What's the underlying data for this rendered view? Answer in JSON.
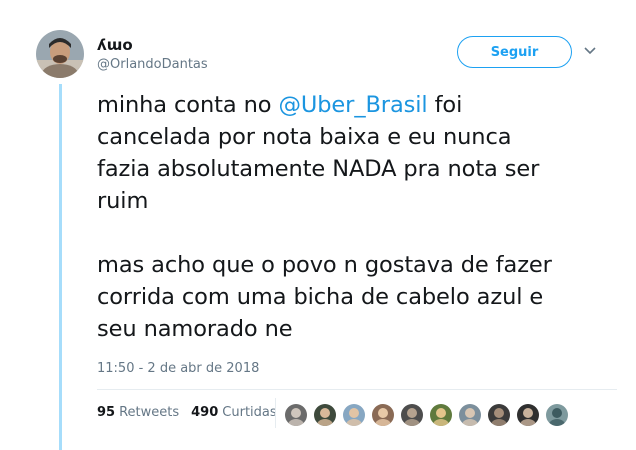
{
  "tweet": {
    "display_name": "ʎɯo",
    "username": "@OrlandoDantas",
    "follow_label": "Seguir",
    "text_line1_prefix": "minha conta no ",
    "mention": "@Uber_Brasil",
    "text_line1_suffix": " foi\ncancelada por nota baixa e eu nunca\nfazia absolutamente NADA pra nota ser\nruim",
    "text_para2": "mas acho que o povo n gostava de fazer\ncorrida com uma bicha de cabelo azul e\nseu namorado ne",
    "timestamp": "11:50 - 2 de abr de 2018",
    "retweets_count": "95",
    "retweets_label": "Retweets",
    "likes_count": "490",
    "likes_label": "Curtidas"
  },
  "colors": {
    "accent": "#1da1f2",
    "mention": "#1b95e0",
    "thread_line": "#a6ddfb",
    "secondary_text": "#657786"
  },
  "icons": {
    "more": "chevron-down-icon"
  },
  "likers": [
    {
      "name": "liker-1",
      "bg": "#6b6b6b",
      "fg": "#cfc6bd"
    },
    {
      "name": "liker-2",
      "bg": "#3e4a3c",
      "fg": "#d9b99a"
    },
    {
      "name": "liker-3",
      "bg": "#87a7c2",
      "fg": "#e2c4a5"
    },
    {
      "name": "liker-4",
      "bg": "#8a6a55",
      "fg": "#e8c9a7"
    },
    {
      "name": "liker-5",
      "bg": "#4d4d4d",
      "fg": "#b5a28f"
    },
    {
      "name": "liker-6",
      "bg": "#5f7a3d",
      "fg": "#e3c58b"
    },
    {
      "name": "liker-7",
      "bg": "#7c8f9c",
      "fg": "#d8c6b3"
    },
    {
      "name": "liker-8",
      "bg": "#3b3b3b",
      "fg": "#a58e7a"
    },
    {
      "name": "liker-9",
      "bg": "#2f2f2f",
      "fg": "#c9b29c"
    },
    {
      "name": "liker-10",
      "bg": "#7e9a9e",
      "fg": "#3d5b60"
    }
  ]
}
